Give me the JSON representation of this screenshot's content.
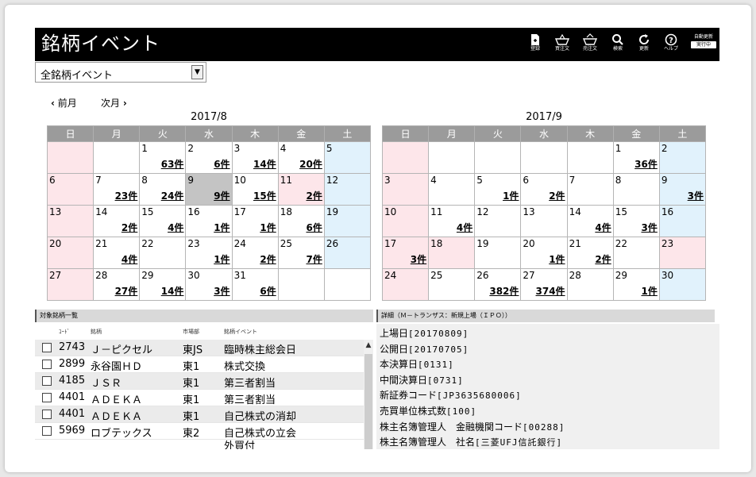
{
  "app": {
    "title": "銘柄イベント",
    "toolbar": [
      {
        "name": "register",
        "label": "登録",
        "icon": "register-icon"
      },
      {
        "name": "buy-order",
        "label": "買注文",
        "icon": "basket-icon"
      },
      {
        "name": "sell-order",
        "label": "売注文",
        "icon": "sell-basket-icon"
      },
      {
        "name": "search",
        "label": "検索",
        "icon": "search-icon"
      },
      {
        "name": "refresh",
        "label": "更新",
        "icon": "refresh-icon"
      },
      {
        "name": "help",
        "label": "ヘルプ",
        "icon": "help-icon"
      }
    ],
    "auto_update": {
      "label": "自動更新",
      "status": "実行中"
    }
  },
  "filter": {
    "selected": "全銘柄イベント"
  },
  "nav": {
    "prev": "前月",
    "next": "次月"
  },
  "weekdays": [
    "日",
    "月",
    "火",
    "水",
    "木",
    "金",
    "土"
  ],
  "calendars": [
    {
      "title": "2017/8",
      "weeks": [
        [
          {
            "d": ""
          },
          {
            "d": ""
          },
          {
            "d": "1",
            "c": "63件"
          },
          {
            "d": "2",
            "c": "6件"
          },
          {
            "d": "3",
            "c": "14件"
          },
          {
            "d": "4",
            "c": "20件"
          },
          {
            "d": "5"
          }
        ],
        [
          {
            "d": "6"
          },
          {
            "d": "7",
            "c": "23件"
          },
          {
            "d": "8",
            "c": "24件"
          },
          {
            "d": "9",
            "c": "9件",
            "today": true
          },
          {
            "d": "10",
            "c": "15件"
          },
          {
            "d": "11",
            "c": "2件",
            "holiday": true
          },
          {
            "d": "12"
          }
        ],
        [
          {
            "d": "13"
          },
          {
            "d": "14",
            "c": "2件"
          },
          {
            "d": "15",
            "c": "4件"
          },
          {
            "d": "16",
            "c": "1件"
          },
          {
            "d": "17",
            "c": "1件"
          },
          {
            "d": "18",
            "c": "6件"
          },
          {
            "d": "19"
          }
        ],
        [
          {
            "d": "20"
          },
          {
            "d": "21",
            "c": "4件"
          },
          {
            "d": "22"
          },
          {
            "d": "23",
            "c": "1件"
          },
          {
            "d": "24",
            "c": "2件"
          },
          {
            "d": "25",
            "c": "7件"
          },
          {
            "d": "26"
          }
        ],
        [
          {
            "d": "27"
          },
          {
            "d": "28",
            "c": "27件"
          },
          {
            "d": "29",
            "c": "14件"
          },
          {
            "d": "30",
            "c": "3件"
          },
          {
            "d": "31",
            "c": "6件"
          },
          {
            "d": ""
          },
          {
            "d": ""
          }
        ]
      ]
    },
    {
      "title": "2017/9",
      "weeks": [
        [
          {
            "d": ""
          },
          {
            "d": ""
          },
          {
            "d": ""
          },
          {
            "d": ""
          },
          {
            "d": ""
          },
          {
            "d": "1",
            "c": "36件"
          },
          {
            "d": "2"
          }
        ],
        [
          {
            "d": "3"
          },
          {
            "d": "4"
          },
          {
            "d": "5",
            "c": "1件"
          },
          {
            "d": "6",
            "c": "2件"
          },
          {
            "d": "7"
          },
          {
            "d": "8"
          },
          {
            "d": "9",
            "c": "3件"
          }
        ],
        [
          {
            "d": "10"
          },
          {
            "d": "11",
            "c": "4件"
          },
          {
            "d": "12"
          },
          {
            "d": "13"
          },
          {
            "d": "14",
            "c": "4件"
          },
          {
            "d": "15",
            "c": "3件"
          },
          {
            "d": "16"
          }
        ],
        [
          {
            "d": "17",
            "c": "3件"
          },
          {
            "d": "18",
            "holiday": true
          },
          {
            "d": "19"
          },
          {
            "d": "20",
            "c": "1件"
          },
          {
            "d": "21",
            "c": "2件"
          },
          {
            "d": "22"
          },
          {
            "d": "23",
            "holiday": true
          }
        ],
        [
          {
            "d": "24"
          },
          {
            "d": "25"
          },
          {
            "d": "26",
            "c": "382件"
          },
          {
            "d": "27",
            "c": "374件"
          },
          {
            "d": "28"
          },
          {
            "d": "29",
            "c": "1件"
          },
          {
            "d": "30"
          }
        ]
      ]
    }
  ],
  "list_panel": {
    "title": "対象銘柄一覧",
    "columns": [
      "ｺｰﾄﾞ",
      "銘柄",
      "市場部",
      "銘柄イベント"
    ],
    "rows": [
      {
        "code": "2743",
        "name": "Ｊ－ピクセル",
        "market": "東JS",
        "event": "臨時株主総会日"
      },
      {
        "code": "2899",
        "name": "永谷園ＨＤ",
        "market": "東1",
        "event": "株式交換"
      },
      {
        "code": "4185",
        "name": "ＪＳＲ",
        "market": "東1",
        "event": "第三者割当"
      },
      {
        "code": "4401",
        "name": "ＡＤＥＫＡ",
        "market": "東1",
        "event": "第三者割当"
      },
      {
        "code": "4401",
        "name": "ＡＤＥＫＡ",
        "market": "東1",
        "event": "自己株式の消却"
      },
      {
        "code": "5969",
        "name": "ロブテックス",
        "market": "東2",
        "event": "自己株式の立会"
      }
    ],
    "overflow_text": "外買付"
  },
  "detail_panel": {
    "title": "詳細（Ｍ－トランザス：新規上場（ＩＰＯ））",
    "lines": [
      {
        "label": "上場日",
        "value": "[20170809]"
      },
      {
        "label": "公開日",
        "value": "[20170705]"
      },
      {
        "label": "本決算日",
        "value": "[0131]"
      },
      {
        "label": "中間決算日",
        "value": "[0731]"
      },
      {
        "label": "新証券コード",
        "value": "[JP3635680006]"
      },
      {
        "label": "売買単位株式数",
        "value": "[100]"
      },
      {
        "label": "株主名簿管理人　金融機関コード",
        "value": "[00288]"
      },
      {
        "label": "株主名簿管理人　社名",
        "value": "[三菱UFJ信託銀行]"
      }
    ]
  }
}
